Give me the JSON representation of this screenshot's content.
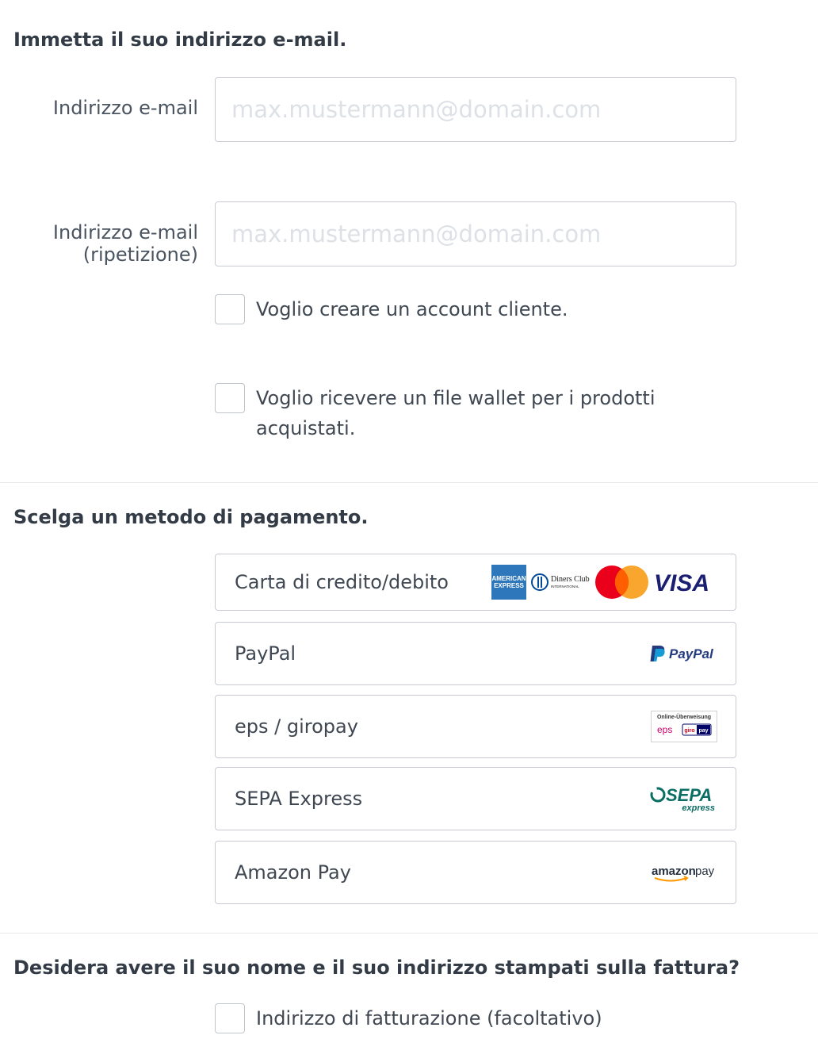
{
  "email_section": {
    "title": "Immetta il suo indirizzo e-mail.",
    "email_label": "Indirizzo e-mail",
    "email_placeholder": "max.mustermann@domain.com",
    "email_repeat_label_line1": "Indirizzo e-mail",
    "email_repeat_label_line2": "(ripetizione)",
    "email_repeat_placeholder": "max.mustermann@domain.com",
    "create_account_label": "Voglio creare un account cliente.",
    "create_account_checked": false,
    "wallet_label_line1": "Voglio ricevere un file wallet per i prodotti",
    "wallet_label_line2": "acquistati.",
    "wallet_checked": false
  },
  "payment_section": {
    "title": "Scelga un metodo di pagamento.",
    "options": [
      {
        "label": "Carta di credito/debito",
        "logos": [
          "amex-logo",
          "diners-club-logo",
          "mastercard-logo",
          "visa-logo"
        ]
      },
      {
        "label": "PayPal",
        "logos": [
          "paypal-logo"
        ]
      },
      {
        "label": "eps / giropay",
        "logos": [
          "eps-giropay-logo"
        ]
      },
      {
        "label": "SEPA Express",
        "logos": [
          "sepa-express-logo"
        ]
      },
      {
        "label": "Amazon Pay",
        "logos": [
          "amazon-pay-logo"
        ]
      }
    ],
    "logo_text": {
      "amex_line1": "AMERICAN",
      "amex_line2": "EXPRESS",
      "diners_line1": "Diners Club",
      "diners_line2": "INTERNATIONAL",
      "visa": "VISA",
      "paypal": "PayPal",
      "eps_header": "Online-Überweisung",
      "eps": "eps",
      "giro": "giro",
      "pay": "pay",
      "sepa": "SEPA",
      "sepa_sub": "express",
      "amazon": "amazon",
      "amazon_pay": "pay"
    }
  },
  "invoice_section": {
    "title": "Desidera avere il suo nome e il suo indirizzo stampati sulla fattura?",
    "billing_label": "Indirizzo di fatturazione (facoltativo)",
    "billing_checked": false
  },
  "colors": {
    "paypal_dark": "#253b80",
    "paypal_light": "#179bd7",
    "visa": "#1a1f71",
    "mastercard_red": "#eb001b",
    "mastercard_orange": "#f79e1b",
    "amex": "#2e77bb",
    "sepa": "#0a6d64",
    "eps": "#c8036f"
  }
}
